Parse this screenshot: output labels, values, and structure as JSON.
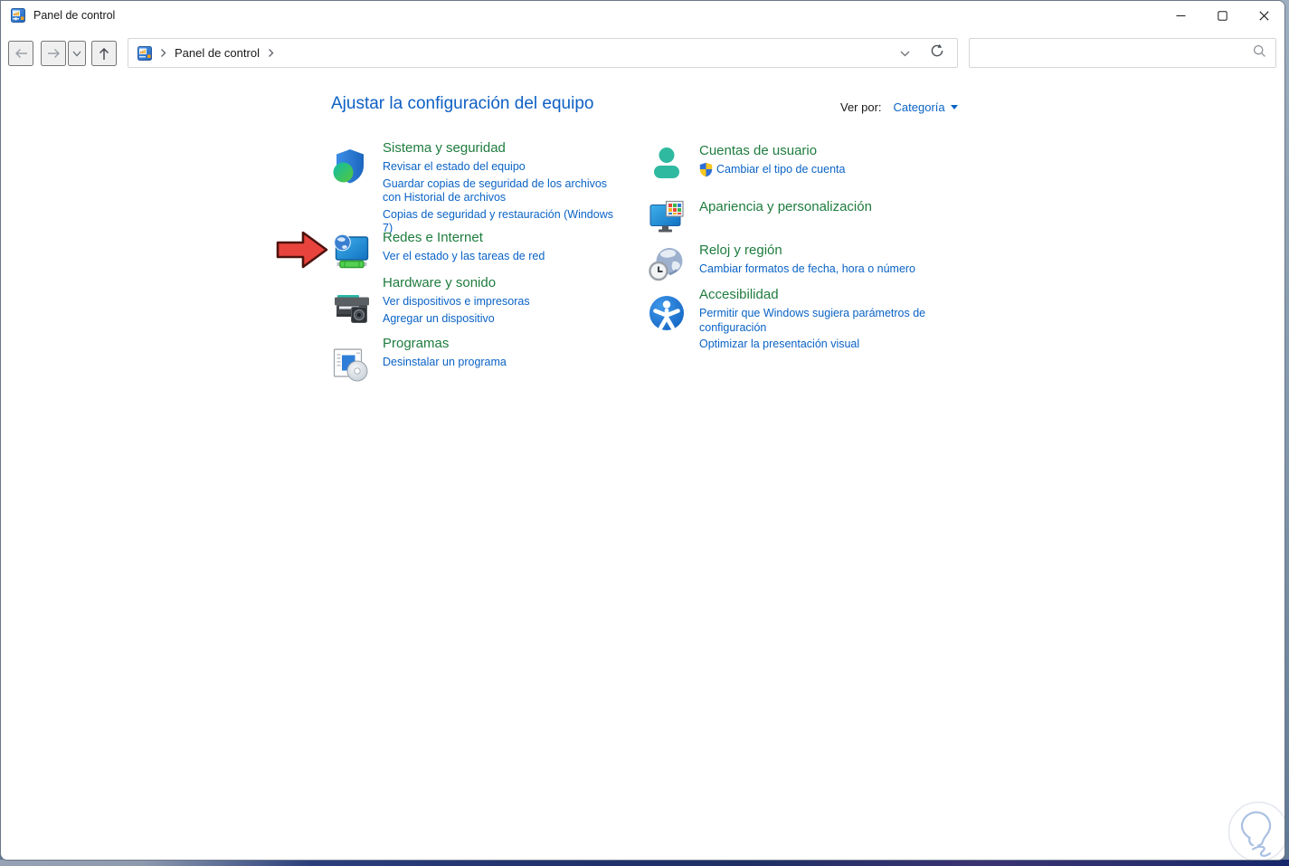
{
  "window": {
    "title": "Panel de control"
  },
  "toolbar": {
    "breadcrumb": {
      "root": "Panel de control"
    },
    "search": {
      "value": "",
      "placeholder": ""
    }
  },
  "page": {
    "heading": "Ajustar la configuración del equipo",
    "view_by_label": "Ver por:",
    "view_by_value": "Categoría"
  },
  "categories": [
    {
      "title": "Sistema y seguridad",
      "icon": "shield-security-icon",
      "links": [
        {
          "label": "Revisar el estado del equipo"
        },
        {
          "label": "Guardar copias de seguridad de los archivos con Historial de archivos"
        },
        {
          "label": "Copias de seguridad y restauración (Windows 7)"
        }
      ]
    },
    {
      "title": "Redes e Internet",
      "icon": "network-monitor-icon",
      "links": [
        {
          "label": "Ver el estado y las tareas de red"
        }
      ]
    },
    {
      "title": "Hardware y sonido",
      "icon": "printer-speaker-icon",
      "links": [
        {
          "label": "Ver dispositivos e impresoras"
        },
        {
          "label": "Agregar un dispositivo"
        }
      ]
    },
    {
      "title": "Programas",
      "icon": "program-disc-icon",
      "links": [
        {
          "label": "Desinstalar un programa"
        }
      ]
    },
    {
      "title": "Cuentas de usuario",
      "icon": "user-icon",
      "links": [
        {
          "label": "Cambiar el tipo de cuenta",
          "uac_shield": true
        }
      ]
    },
    {
      "title": "Apariencia y personalización",
      "icon": "appearance-monitor-icon",
      "links": []
    },
    {
      "title": "Reloj y región",
      "icon": "globe-clock-icon",
      "links": [
        {
          "label": "Cambiar formatos de fecha, hora o número"
        }
      ]
    },
    {
      "title": "Accesibilidad",
      "icon": "accessibility-icon",
      "links": [
        {
          "label": "Permitir que Windows sugiera parámetros de configuración"
        },
        {
          "label": "Optimizar la presentación visual"
        }
      ]
    }
  ],
  "annotation": {
    "type": "red-arrow",
    "points_at": "Redes e Internet"
  },
  "colors": {
    "category_title": "#1E7C3E",
    "link": "#0A63C6",
    "heading": "#0E60C4",
    "arrow_fill": "#E8443D",
    "arrow_outline": "#4F130E",
    "desktop_bar_blue": "#22326E"
  }
}
